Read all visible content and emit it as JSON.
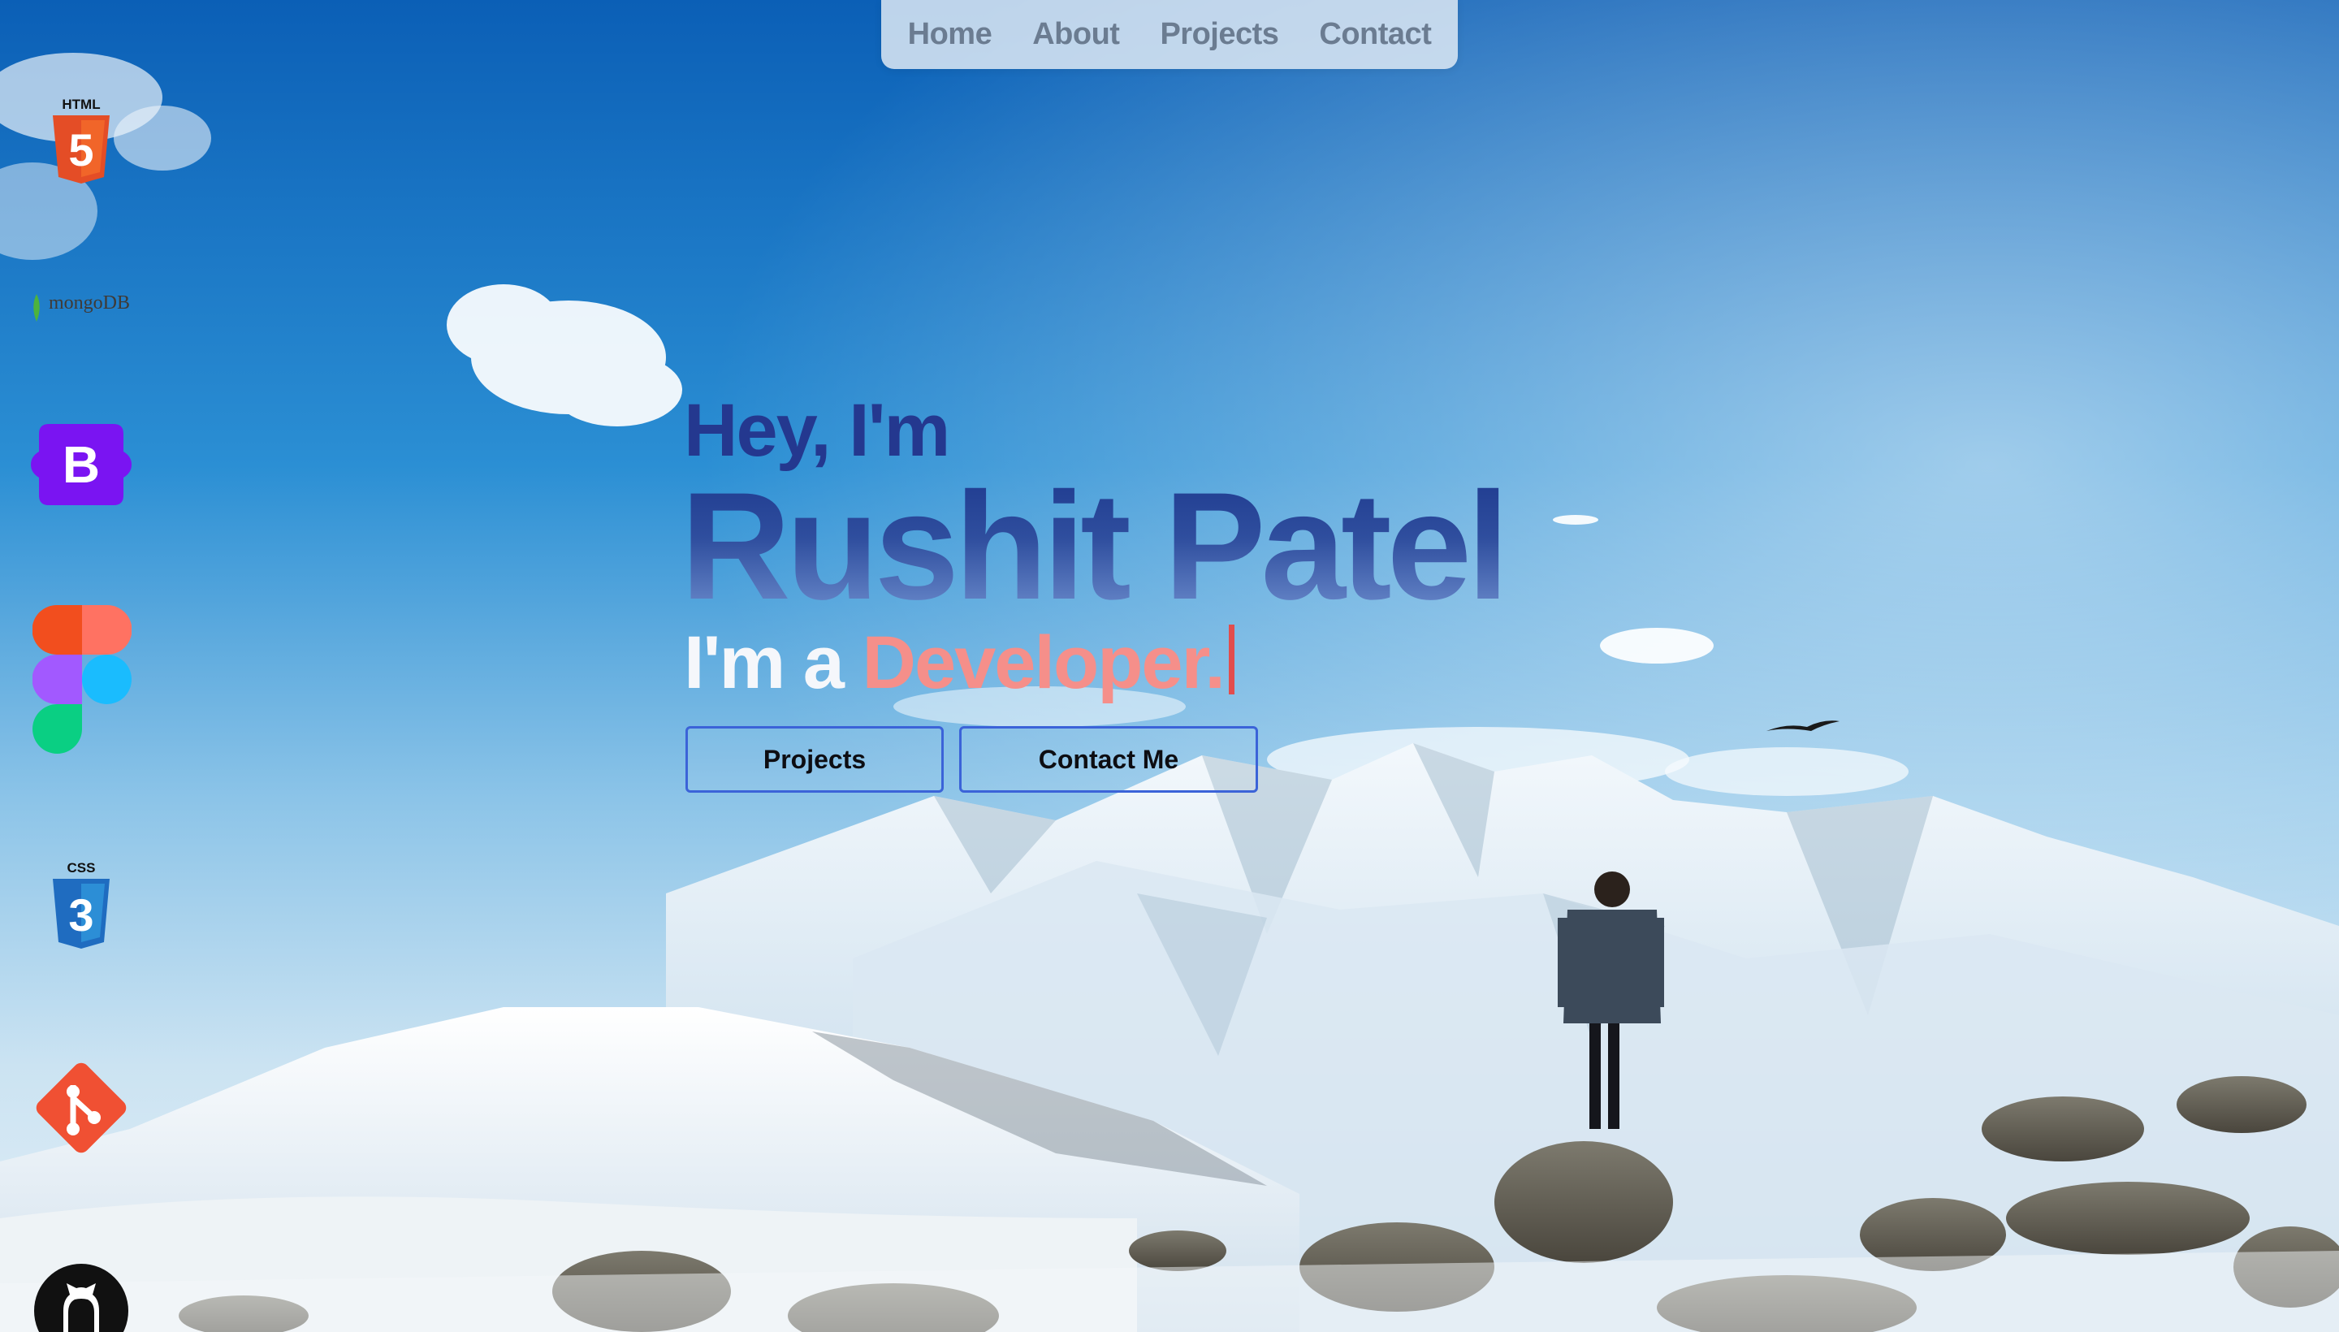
{
  "nav": {
    "items": [
      {
        "label": "Home"
      },
      {
        "label": "About"
      },
      {
        "label": "Projects"
      },
      {
        "label": "Contact"
      }
    ]
  },
  "skills": {
    "html": {
      "icon": "html5-icon",
      "label": "HTML",
      "digit": "5",
      "color": "#e44d26"
    },
    "mongo": {
      "icon": "mongodb-icon",
      "label": "mongoDB",
      "color": "#4db33d"
    },
    "bootstrap": {
      "icon": "bootstrap-icon",
      "letter": "B",
      "color": "#7a14f2"
    },
    "figma": {
      "icon": "figma-icon",
      "colors": [
        "#f24e1e",
        "#ff7262",
        "#a259ff",
        "#1abcfe",
        "#0acf83"
      ]
    },
    "css": {
      "icon": "css3-icon",
      "label": "CSS",
      "digit": "3",
      "color": "#1f6cc0"
    },
    "git": {
      "icon": "git-icon",
      "color": "#f05033"
    },
    "github": {
      "icon": "github-icon",
      "color": "#111111"
    }
  },
  "hero": {
    "greeting": "Hey, I'm",
    "name": "Rushit Patel",
    "role_prefix": "I'm a",
    "role_word": "Developer.",
    "buttons": {
      "projects": "Projects",
      "contact": "Contact Me"
    }
  },
  "colors": {
    "sky_top": "#0b63b8",
    "accent": "#3b63d8",
    "greeting": "#24388f",
    "role_highlight": "#f58f8a",
    "cursor": "#e24d4d"
  }
}
